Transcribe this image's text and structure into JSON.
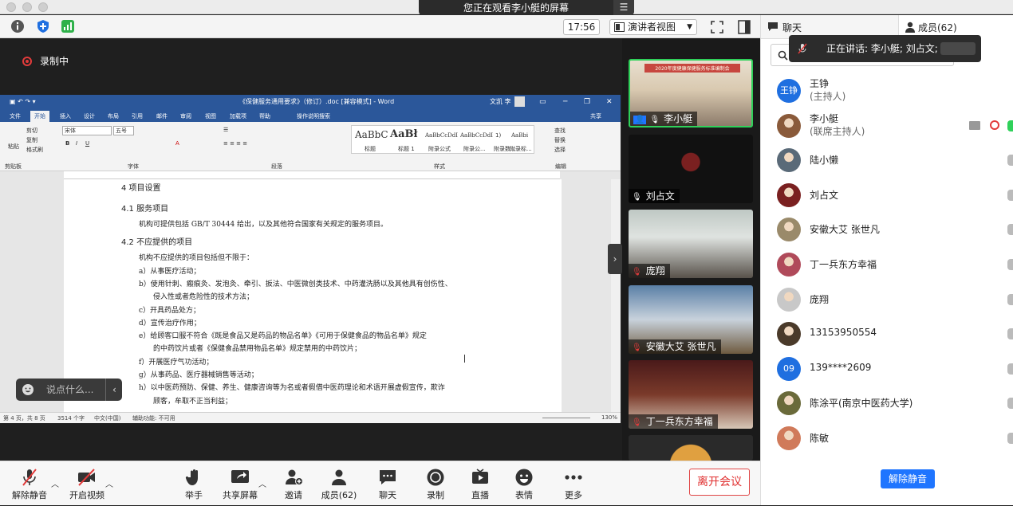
{
  "banner": {
    "text": "您正在观看李小艇的屏幕",
    "menu_glyph": "☰"
  },
  "toolbar": {
    "time": "17:56",
    "view_label": "演讲者视图"
  },
  "recording": {
    "label": "录制中"
  },
  "word": {
    "title": "《保健服务通用要求》（修订）.doc [兼容模式] - Word",
    "user": "文凯 李",
    "tabs": [
      "文件",
      "开始",
      "插入",
      "设计",
      "布局",
      "引用",
      "邮件",
      "审阅",
      "视图",
      "加载项",
      "帮助",
      "操作说明搜索"
    ],
    "share": "共享",
    "clipboard": [
      "剪切",
      "复制",
      "粘贴",
      "格式刷"
    ],
    "font_name": "宋体",
    "font_size": "五号",
    "group_labels": [
      "剪贴板",
      "字体",
      "段落",
      "样式",
      "编辑"
    ],
    "styles": [
      {
        "preview": "AaBbC",
        "label": "标题"
      },
      {
        "preview": "AaBł",
        "label": "标题 1"
      },
      {
        "preview": "AaBbCcDdI",
        "label": "附录公式"
      },
      {
        "preview": "AaBbCcDdI",
        "label": "附录公..."
      },
      {
        "preview": "1)",
        "label": "附录数..."
      },
      {
        "preview": "AaBbi",
        "label": "附录标..."
      }
    ],
    "editing": [
      "查找",
      "替换",
      "选择"
    ],
    "doc_lines": [
      {
        "text": "4  项目设置",
        "indent": 0,
        "bold": true
      },
      {
        "text": "4.1    服务项目",
        "indent": 0,
        "bold": true
      },
      {
        "text": "机构可提供包括 GB/T 30444 给出，以及其他符合国家有关规定的服务项目。",
        "indent": 1
      },
      {
        "text": "4.2   不应提供的项目",
        "indent": 0,
        "bold": true
      },
      {
        "text": "机构不应提供的项目包括但不限于：",
        "indent": 1
      },
      {
        "text": "a）从事医疗活动；",
        "indent": 2
      },
      {
        "text": "b）使用针刺、瘢痕灸、发泡灸、牵引、扳法、中医微创类技术、中药灌洗肠以及其他具有创伤性、",
        "indent": 2
      },
      {
        "text": "侵入性或者危险性的技术方法；",
        "indent": 3
      },
      {
        "text": "c）开具药品处方；",
        "indent": 2
      },
      {
        "text": "d）宣传治疗作用；",
        "indent": 2
      },
      {
        "text": "e）给顾客口服不符合《既是食品又是药品的物品名单》《可用于保健食品的物品名单》规定",
        "indent": 2
      },
      {
        "text": "的中药饮片或者《保健食品禁用物品名单》规定禁用的中药饮片；",
        "indent": 3
      },
      {
        "text": "f）开展医疗气功活动；",
        "indent": 2
      },
      {
        "text": "g）从事药品、医疗器械销售等活动；",
        "indent": 2
      },
      {
        "text": "h）以中医药预防、保健、养生、健康咨询等为名或者假借中医药理论和术语开展虚假宣传，欺诈",
        "indent": 2
      },
      {
        "text": "顾客，牟取不正当利益；",
        "indent": 3
      }
    ],
    "status": {
      "page": "第 4 页，共 8 页",
      "words": "3514 个字",
      "lang": "中文(中国)",
      "access": "辅助功能: 不可用",
      "zoom": "130%"
    }
  },
  "chat_input": {
    "placeholder": "说点什么..."
  },
  "videos": [
    {
      "name": "李小艇",
      "mic": "on",
      "active": true,
      "screen_title": "2020年度健康保健服务标准编制会"
    },
    {
      "name": "刘占文",
      "mic": "on",
      "active": false
    },
    {
      "name": "庞翔",
      "mic": "muted",
      "active": false
    },
    {
      "name": "安徽大艾 张世凡",
      "mic": "muted",
      "active": false
    },
    {
      "name": "丁一兵东方幸福",
      "mic": "muted",
      "active": false
    }
  ],
  "panel": {
    "tab_chat": "聊天",
    "tab_members": "成员(62)",
    "speaking": "正在讲话: 李小艇; 刘占文;",
    "members": [
      {
        "name": "王铮",
        "role": "(主持人)",
        "avatar": "text",
        "avatar_text": "王铮",
        "color": "#1f6fe0"
      },
      {
        "name": "李小艇",
        "role": "(联席主持人)",
        "avatar": "photo",
        "color": "#8a5a3a"
      },
      {
        "name": "陆小懒",
        "role": "",
        "avatar": "photo",
        "color": "#5a6a78"
      },
      {
        "name": "刘占文",
        "role": "",
        "avatar": "photo",
        "color": "#7a2020"
      },
      {
        "name": "安徽大艾 张世凡",
        "role": "",
        "avatar": "photo",
        "color": "#9a8a6a"
      },
      {
        "name": "丁一兵东方幸福",
        "role": "",
        "avatar": "photo",
        "color": "#b04a5a"
      },
      {
        "name": "庞翔",
        "role": "",
        "avatar": "photo",
        "color": "#c8c8c8"
      },
      {
        "name": "13153950554",
        "role": "",
        "avatar": "photo",
        "color": "#4a3a2a"
      },
      {
        "name": "139****2609",
        "role": "",
        "avatar": "text",
        "avatar_text": "09",
        "color": "#1f6fe0"
      },
      {
        "name": "陈涂平(南京中医药大学)",
        "role": "",
        "avatar": "photo",
        "color": "#6a6a3a"
      },
      {
        "name": "陈敏",
        "role": "",
        "avatar": "photo",
        "color": "#d07a5a"
      }
    ],
    "unmute_all": "解除静音"
  },
  "bottom": {
    "unmute": "解除静音",
    "video": "开启视频",
    "raise_hand": "举手",
    "share": "共享屏幕",
    "invite": "邀请",
    "members": "成员(62)",
    "chat": "聊天",
    "record": "录制",
    "live": "直播",
    "reactions": "表情",
    "more": "更多",
    "leave": "离开会议"
  }
}
